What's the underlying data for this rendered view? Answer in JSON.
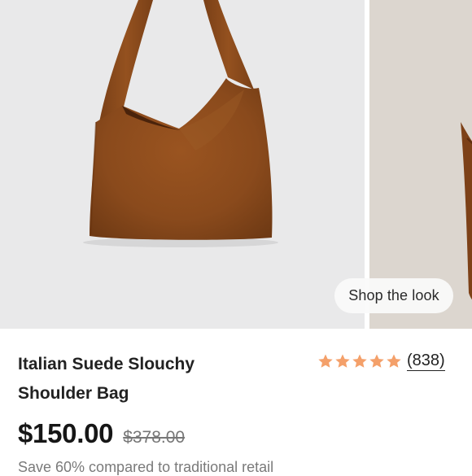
{
  "gallery": {
    "shop_the_look_label": "Shop the look",
    "image_colors": {
      "main_background": "#e9e9ea",
      "bag_suede": "#8a4a1c",
      "next_background": "#dcd6cf"
    }
  },
  "product": {
    "title": "Italian Suede Slouchy Shoulder Bag",
    "rating": {
      "stars": 5,
      "max_stars": 5,
      "review_count": "(838)",
      "star_color": "#f4a06a"
    },
    "price": "$150.00",
    "original_price": "$378.00",
    "savings_text": "Save 60% compared to traditional retail"
  }
}
